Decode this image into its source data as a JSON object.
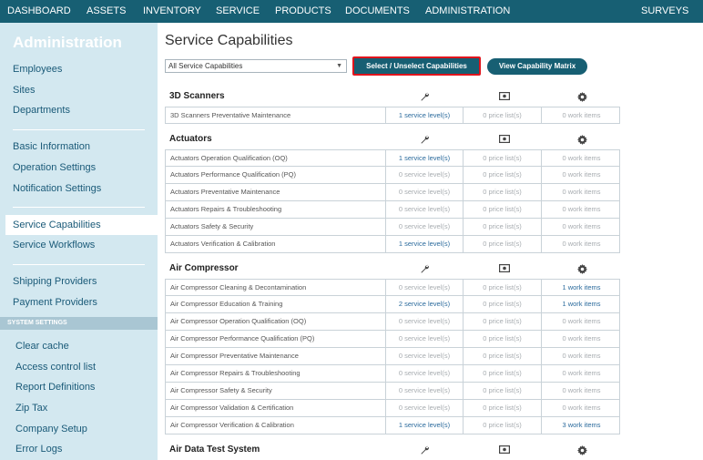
{
  "topnav": {
    "items": [
      "DASHBOARD",
      "ASSETS",
      "INVENTORY",
      "SERVICE",
      "PRODUCTS",
      "DOCUMENTS",
      "ADMINISTRATION"
    ],
    "right": "SURVEYS"
  },
  "sidebar": {
    "heading": "Administration",
    "links": [
      "Employees",
      "Sites",
      "Departments",
      "Basic Information",
      "Operation Settings",
      "Notification Settings",
      "Service Capabilities",
      "Service Workflows",
      "Shipping Providers",
      "Payment Providers"
    ],
    "active": "Service Capabilities",
    "system_settings_label": "SYSTEM SETTINGS",
    "system_links": [
      "Clear cache",
      "Access control list",
      "Report Definitions",
      "Zip Tax",
      "Company Setup",
      "Error Logs"
    ]
  },
  "main": {
    "title": "Service Capabilities",
    "filter_select": "All Service Capabilities",
    "select_button": "Select / Unselect Capabilities",
    "matrix_button": "View Capability Matrix",
    "column_icons": [
      "wrench-icon",
      "money-icon",
      "gear-icon"
    ],
    "groups": [
      {
        "title": "3D Scanners",
        "rows": [
          {
            "name": "3D Scanners Preventative Maintenance",
            "service": "1 service level(s)",
            "price": "0 price list(s)",
            "work": "0 work items"
          }
        ]
      },
      {
        "title": "Actuators",
        "rows": [
          {
            "name": "Actuators Operation Qualification (OQ)",
            "service": "1 service level(s)",
            "price": "0 price list(s)",
            "work": "0 work items"
          },
          {
            "name": "Actuators Performance Qualification (PQ)",
            "service": "0 service level(s)",
            "price": "0 price list(s)",
            "work": "0 work items"
          },
          {
            "name": "Actuators Preventative Maintenance",
            "service": "0 service level(s)",
            "price": "0 price list(s)",
            "work": "0 work items"
          },
          {
            "name": "Actuators Repairs & Troubleshooting",
            "service": "0 service level(s)",
            "price": "0 price list(s)",
            "work": "0 work items"
          },
          {
            "name": "Actuators Safety & Security",
            "service": "0 service level(s)",
            "price": "0 price list(s)",
            "work": "0 work items"
          },
          {
            "name": "Actuators Verification & Calibration",
            "service": "1 service level(s)",
            "price": "0 price list(s)",
            "work": "0 work items"
          }
        ]
      },
      {
        "title": "Air Compressor",
        "rows": [
          {
            "name": "Air Compressor Cleaning & Decontamination",
            "service": "0 service level(s)",
            "price": "0 price list(s)",
            "work": "1 work items"
          },
          {
            "name": "Air Compressor Education & Training",
            "service": "2 service level(s)",
            "price": "0 price list(s)",
            "work": "1 work items"
          },
          {
            "name": "Air Compressor Operation Qualification (OQ)",
            "service": "0 service level(s)",
            "price": "0 price list(s)",
            "work": "0 work items"
          },
          {
            "name": "Air Compressor Performance Qualification (PQ)",
            "service": "0 service level(s)",
            "price": "0 price list(s)",
            "work": "0 work items"
          },
          {
            "name": "Air Compressor Preventative Maintenance",
            "service": "0 service level(s)",
            "price": "0 price list(s)",
            "work": "0 work items"
          },
          {
            "name": "Air Compressor Repairs & Troubleshooting",
            "service": "0 service level(s)",
            "price": "0 price list(s)",
            "work": "0 work items"
          },
          {
            "name": "Air Compressor Safety & Security",
            "service": "0 service level(s)",
            "price": "0 price list(s)",
            "work": "0 work items"
          },
          {
            "name": "Air Compressor Validation & Certification",
            "service": "0 service level(s)",
            "price": "0 price list(s)",
            "work": "0 work items"
          },
          {
            "name": "Air Compressor Verification & Calibration",
            "service": "1 service level(s)",
            "price": "0 price list(s)",
            "work": "3 work items"
          }
        ]
      },
      {
        "title": "Air Data Test System",
        "rows": []
      }
    ]
  },
  "colors": {
    "nav": "#175f73",
    "sidebar": "#d3e8f0",
    "highlight_border": "#e0141c",
    "link": "#2a6a9c"
  }
}
